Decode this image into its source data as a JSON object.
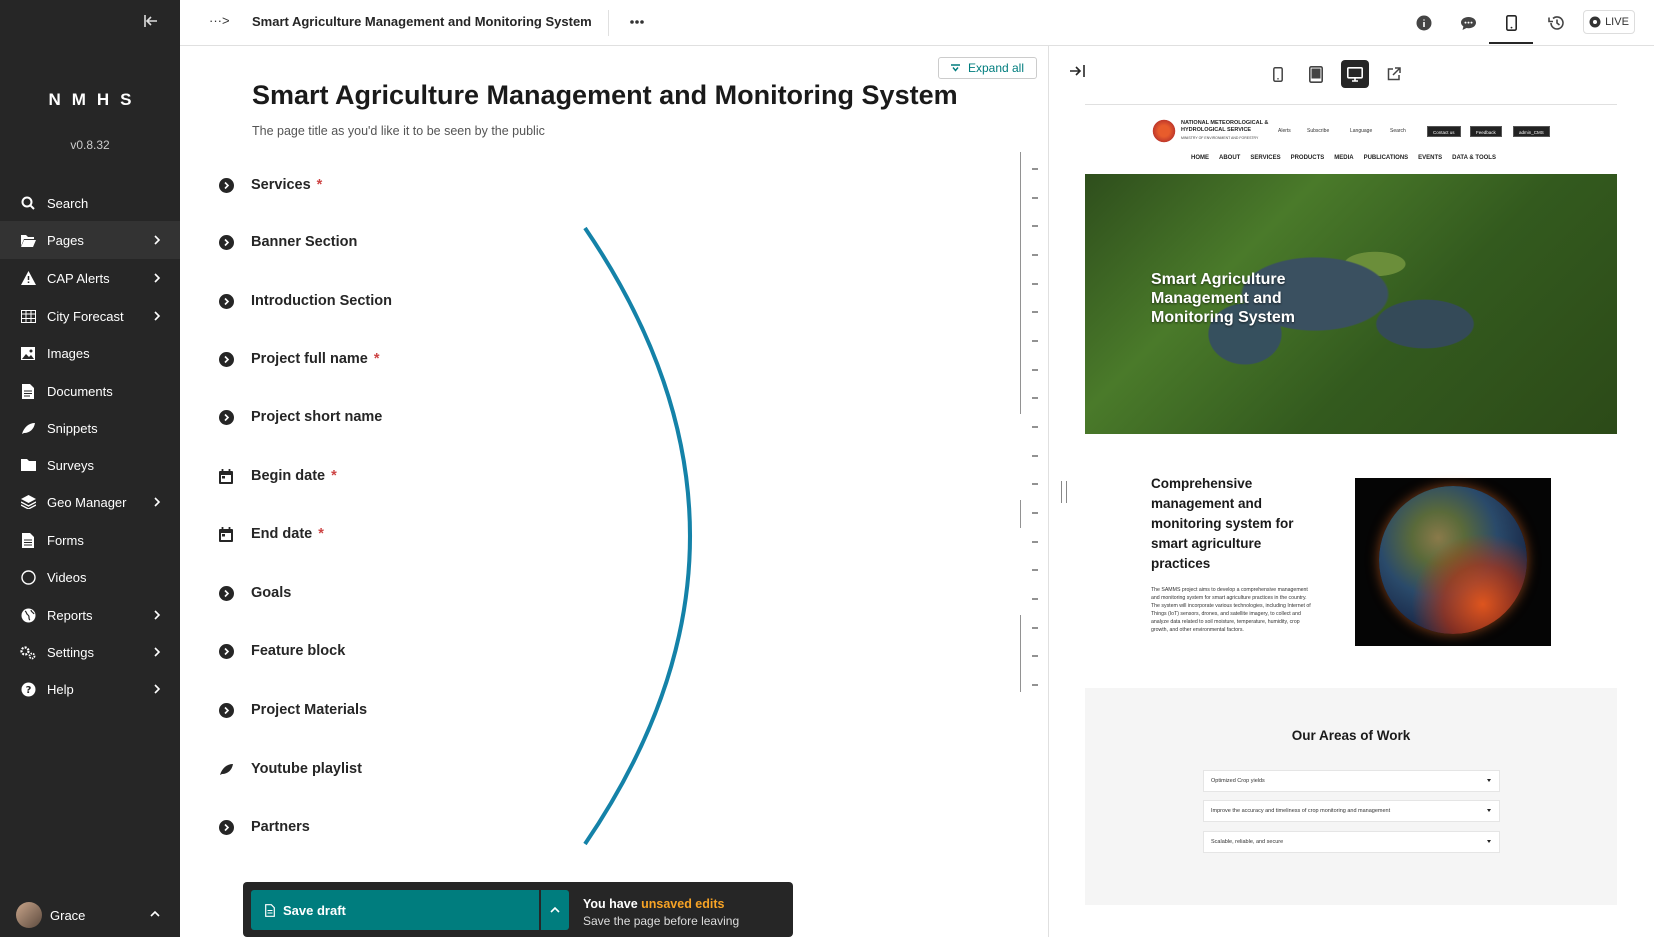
{
  "sidebar": {
    "brand": "NMHS",
    "version": "v0.8.32",
    "items": [
      {
        "label": "Search",
        "icon": "search-icon",
        "has_children": false
      },
      {
        "label": "Pages",
        "icon": "folder-open-icon",
        "has_children": true,
        "active": true
      },
      {
        "label": "CAP Alerts",
        "icon": "warning-icon",
        "has_children": true
      },
      {
        "label": "City Forecast",
        "icon": "table-icon",
        "has_children": true
      },
      {
        "label": "Images",
        "icon": "image-icon",
        "has_children": false
      },
      {
        "label": "Documents",
        "icon": "document-icon",
        "has_children": false
      },
      {
        "label": "Snippets",
        "icon": "snippet-icon",
        "has_children": false
      },
      {
        "label": "Surveys",
        "icon": "folder-icon",
        "has_children": false
      },
      {
        "label": "Geo Manager",
        "icon": "layers-icon",
        "has_children": true
      },
      {
        "label": "Forms",
        "icon": "forms-icon",
        "has_children": false
      },
      {
        "label": "Videos",
        "icon": "video-icon",
        "has_children": false
      },
      {
        "label": "Reports",
        "icon": "globe-icon",
        "has_children": true
      },
      {
        "label": "Settings",
        "icon": "cogs-icon",
        "has_children": true
      },
      {
        "label": "Help",
        "icon": "help-icon",
        "has_children": true
      }
    ],
    "user": {
      "name": "Grace"
    }
  },
  "topbar": {
    "breadcrumb_toggle": "···>",
    "title": "Smart Agriculture Management and Monitoring System",
    "live_label": "LIVE"
  },
  "editor": {
    "expand_all": "Expand all",
    "heading": "Smart Agriculture Management and Monitoring System",
    "help_text": "The page title as you'd like it to be seen by the public",
    "fields": [
      {
        "label": "Services",
        "required": true,
        "icon": "expand-circle-icon"
      },
      {
        "label": "Banner Section",
        "required": false,
        "icon": "expand-circle-icon"
      },
      {
        "label": "Introduction Section",
        "required": false,
        "icon": "expand-circle-icon"
      },
      {
        "label": "Project full name",
        "required": true,
        "icon": "expand-circle-icon"
      },
      {
        "label": "Project short name",
        "required": false,
        "icon": "expand-circle-icon"
      },
      {
        "label": "Begin date",
        "required": true,
        "icon": "calendar-icon"
      },
      {
        "label": "End date",
        "required": true,
        "icon": "calendar-icon"
      },
      {
        "label": "Goals",
        "required": false,
        "icon": "expand-circle-icon"
      },
      {
        "label": "Feature block",
        "required": false,
        "icon": "expand-circle-icon"
      },
      {
        "label": "Project Materials",
        "required": false,
        "icon": "expand-circle-icon"
      },
      {
        "label": "Youtube playlist",
        "required": false,
        "icon": "snippet-icon"
      },
      {
        "label": "Partners",
        "required": false,
        "icon": "expand-circle-icon"
      }
    ],
    "required_marker": "*"
  },
  "savebar": {
    "save_label": "Save draft",
    "notice_prefix": "You have ",
    "notice_accent": "unsaved edits",
    "notice_sub": "Save the page before leaving"
  },
  "preview": {
    "site": {
      "name": "NATIONAL METEOROLOGICAL & HYDROLOGICAL SERVICE",
      "tagline": "MINISTRY OF ENVIRONMENT AND FORESTRY",
      "util": [
        "Alerts",
        "Subscribe",
        "Language",
        "Search"
      ],
      "buttons": [
        "Contact us",
        "Feedback",
        "admin_CMS"
      ],
      "nav": [
        "HOME",
        "ABOUT",
        "SERVICES",
        "PRODUCTS",
        "MEDIA",
        "PUBLICATIONS",
        "EVENTS",
        "DATA & TOOLS"
      ]
    },
    "hero_title": "Smart Agriculture Management and Monitoring System",
    "intro_title": "Comprehensive management and monitoring system for smart agriculture practices",
    "intro_body": "The SAMMS project aims to develop a comprehensive management and monitoring system for smart agriculture practices in the country. The system will incorporate various technologies, including Internet of Things (IoT) sensors, drones, and satellite imagery, to collect and analyze data related to soil moisture, temperature, humidity, crop growth, and other environmental factors.",
    "areas_title": "Our Areas of Work",
    "areas": [
      "Optimized Crop yields",
      "Improve the accuracy and timeliness of crop monitoring and management",
      "Scalable, reliable, and secure"
    ]
  },
  "colors": {
    "sidebar": "#262626",
    "accent": "#007d7e",
    "warning": "#f7a325",
    "required": "#cd4444",
    "arc": "#1482a8"
  }
}
